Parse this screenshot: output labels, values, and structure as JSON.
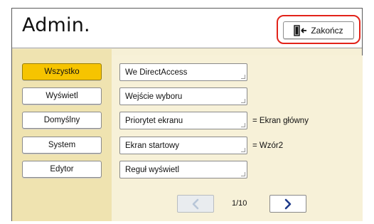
{
  "header": {
    "title": "Admin.",
    "exit_label": "Zakończ"
  },
  "categories": [
    {
      "label": "Wszystko",
      "active": true
    },
    {
      "label": "Wyświetl",
      "active": false
    },
    {
      "label": "Domyślny",
      "active": false
    },
    {
      "label": "System",
      "active": false
    },
    {
      "label": "Edytor",
      "active": false
    }
  ],
  "items": [
    {
      "label": "We DirectAccess",
      "value": ""
    },
    {
      "label": "Wejście wyboru",
      "value": ""
    },
    {
      "label": "Priorytet ekranu",
      "value": "= Ekran główny"
    },
    {
      "label": "Ekran startowy",
      "value": "= Wzór2"
    },
    {
      "label": "Reguł wyświetl",
      "value": ""
    }
  ],
  "pagination": {
    "indicator": "1/10",
    "prev_enabled": false,
    "next_enabled": true
  },
  "colors": {
    "accent": "#f6c400",
    "exit_highlight": "#e2231a",
    "arrow": "#1e3a8a"
  }
}
